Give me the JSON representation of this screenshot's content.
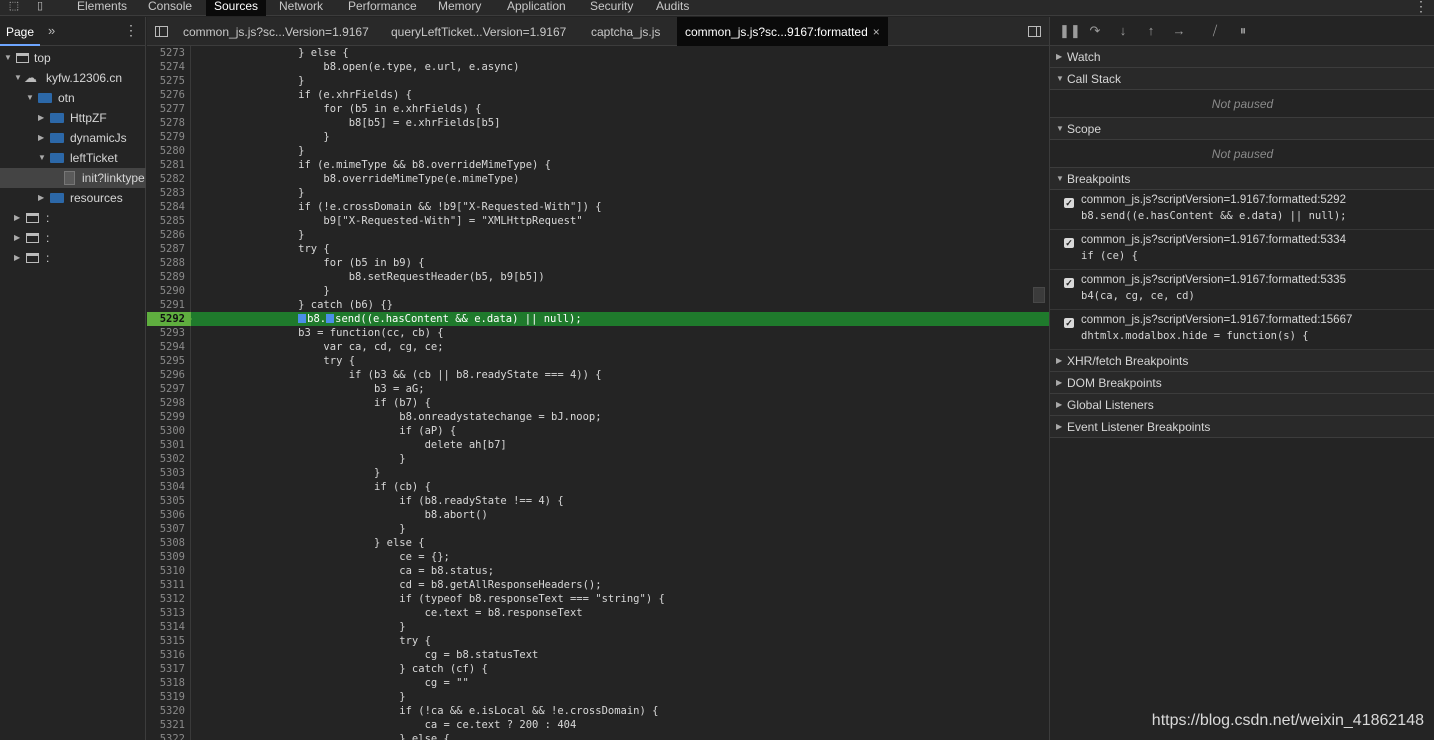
{
  "devtools": {
    "tabs": [
      "Elements",
      "Console",
      "Sources",
      "Network",
      "Performance",
      "Memory",
      "Application",
      "Security",
      "Audits"
    ],
    "active_tab": "Sources"
  },
  "navigator": {
    "tab_label": "Page",
    "more_label": "»",
    "tree": [
      {
        "label": "top",
        "kind": "frame"
      },
      {
        "label": "kyfw.12306.cn",
        "kind": "cloud"
      },
      {
        "label": "otn",
        "kind": "folder"
      },
      {
        "label": "HttpZF",
        "kind": "folder"
      },
      {
        "label": "dynamicJs",
        "kind": "folder"
      },
      {
        "label": "leftTicket",
        "kind": "folder"
      },
      {
        "label": "init?linktype",
        "kind": "file"
      },
      {
        "label": "resources",
        "kind": "folder"
      },
      {
        "label": ":",
        "kind": "frame"
      },
      {
        "label": ":",
        "kind": "frame"
      },
      {
        "label": ":",
        "kind": "frame"
      }
    ]
  },
  "editor": {
    "tabs": [
      {
        "label": "common_js.js?sc...Version=1.9167"
      },
      {
        "label": "queryLeftTicket...Version=1.9167"
      },
      {
        "label": "captcha_js.js"
      },
      {
        "label": "common_js.js?sc...9167:formatted"
      }
    ],
    "active_tab_close": "×",
    "breakpoint_line": "5292",
    "lines": [
      {
        "n": "5273",
        "t": "                } else {"
      },
      {
        "n": "5274",
        "t": "                    b8.open(e.type, e.url, e.async)"
      },
      {
        "n": "5275",
        "t": "                }"
      },
      {
        "n": "5276",
        "t": "                if (e.xhrFields) {"
      },
      {
        "n": "5277",
        "t": "                    for (b5 in e.xhrFields) {"
      },
      {
        "n": "5278",
        "t": "                        b8[b5] = e.xhrFields[b5]"
      },
      {
        "n": "5279",
        "t": "                    }"
      },
      {
        "n": "5280",
        "t": "                }"
      },
      {
        "n": "5281",
        "t": "                if (e.mimeType && b8.overrideMimeType) {"
      },
      {
        "n": "5282",
        "t": "                    b8.overrideMimeType(e.mimeType)"
      },
      {
        "n": "5283",
        "t": "                }"
      },
      {
        "n": "5284",
        "t": "                if (!e.crossDomain && !b9[\"X-Requested-With\"]) {"
      },
      {
        "n": "5285",
        "t": "                    b9[\"X-Requested-With\"] = \"XMLHttpRequest\""
      },
      {
        "n": "5286",
        "t": "                }"
      },
      {
        "n": "5287",
        "t": "                try {"
      },
      {
        "n": "5288",
        "t": "                    for (b5 in b9) {"
      },
      {
        "n": "5289",
        "t": "                        b8.setRequestHeader(b5, b9[b5])"
      },
      {
        "n": "5290",
        "t": "                    }"
      },
      {
        "n": "5291",
        "t": "                } catch (b6) {}"
      },
      {
        "n": "5292",
        "t": "send((e.hasContent && e.data) || null);",
        "pre": "                ",
        "mid": "b8."
      },
      {
        "n": "5293",
        "t": "                b3 = function(cc, cb) {"
      },
      {
        "n": "5294",
        "t": "                    var ca, cd, cg, ce;"
      },
      {
        "n": "5295",
        "t": "                    try {"
      },
      {
        "n": "5296",
        "t": "                        if (b3 && (cb || b8.readyState === 4)) {"
      },
      {
        "n": "5297",
        "t": "                            b3 = aG;"
      },
      {
        "n": "5298",
        "t": "                            if (b7) {"
      },
      {
        "n": "5299",
        "t": "                                b8.onreadystatechange = bJ.noop;"
      },
      {
        "n": "5300",
        "t": "                                if (aP) {"
      },
      {
        "n": "5301",
        "t": "                                    delete ah[b7]"
      },
      {
        "n": "5302",
        "t": "                                }"
      },
      {
        "n": "5303",
        "t": "                            }"
      },
      {
        "n": "5304",
        "t": "                            if (cb) {"
      },
      {
        "n": "5305",
        "t": "                                if (b8.readyState !== 4) {"
      },
      {
        "n": "5306",
        "t": "                                    b8.abort()"
      },
      {
        "n": "5307",
        "t": "                                }"
      },
      {
        "n": "5308",
        "t": "                            } else {"
      },
      {
        "n": "5309",
        "t": "                                ce = {};"
      },
      {
        "n": "5310",
        "t": "                                ca = b8.status;"
      },
      {
        "n": "5311",
        "t": "                                cd = b8.getAllResponseHeaders();"
      },
      {
        "n": "5312",
        "t": "                                if (typeof b8.responseText === \"string\") {"
      },
      {
        "n": "5313",
        "t": "                                    ce.text = b8.responseText"
      },
      {
        "n": "5314",
        "t": "                                }"
      },
      {
        "n": "5315",
        "t": "                                try {"
      },
      {
        "n": "5316",
        "t": "                                    cg = b8.statusText"
      },
      {
        "n": "5317",
        "t": "                                } catch (cf) {"
      },
      {
        "n": "5318",
        "t": "                                    cg = \"\""
      },
      {
        "n": "5319",
        "t": "                                }"
      },
      {
        "n": "5320",
        "t": "                                if (!ca && e.isLocal && !e.crossDomain) {"
      },
      {
        "n": "5321",
        "t": "                                    ca = ce.text ? 200 : 404"
      },
      {
        "n": "5322",
        "t": "                                } else {"
      }
    ]
  },
  "debugger": {
    "sections": {
      "watch": "Watch",
      "call_stack": "Call Stack",
      "scope": "Scope",
      "breakpoints": "Breakpoints",
      "xhr": "XHR/fetch Breakpoints",
      "dom": "DOM Breakpoints",
      "global": "Global Listeners",
      "event": "Event Listener Breakpoints"
    },
    "not_paused": "Not paused",
    "breakpoints": [
      {
        "location": "common_js.js?scriptVersion=1.9167:formatted:5292",
        "code": "b8.send((e.hasContent && e.data) || null);",
        "checked": true
      },
      {
        "location": "common_js.js?scriptVersion=1.9167:formatted:5334",
        "code": "if (ce) {",
        "checked": true
      },
      {
        "location": "common_js.js?scriptVersion=1.9167:formatted:5335",
        "code": "b4(ca, cg, ce, cd)",
        "checked": true
      },
      {
        "location": "common_js.js?scriptVersion=1.9167:formatted:15667",
        "code": "dhtmlx.modalbox.hide = function(s) {",
        "checked": true
      }
    ]
  },
  "watermark": "https://blog.csdn.net/weixin_41862148",
  "colors": {
    "breakpoint_line_bg": "#1f7a2c",
    "breakpoint_marker": "#5fae3f",
    "folder": "#2c68a8",
    "active_tab_underline": "#6ea6ff"
  }
}
